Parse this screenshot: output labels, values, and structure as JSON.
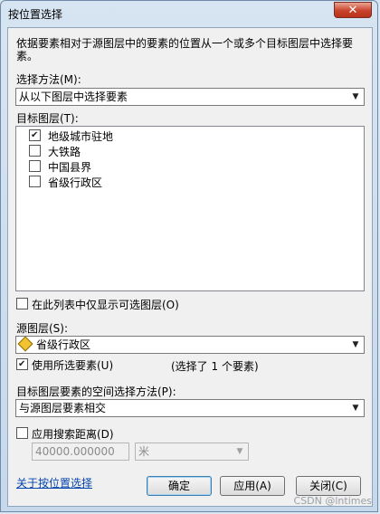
{
  "window": {
    "title": "按位置选择",
    "close_glyph": "✕"
  },
  "description": "依据要素相对于源图层中的要素的位置从一个或多个目标图层中选择要素。",
  "selection_method": {
    "label": "选择方法(M):",
    "value": "从以下图层中选择要素"
  },
  "target_layers": {
    "label": "目标图层(T):",
    "items": [
      {
        "label": "地级城市驻地",
        "checked": true
      },
      {
        "label": "大铁路",
        "checked": false
      },
      {
        "label": "中国县界",
        "checked": false
      },
      {
        "label": "省级行政区",
        "checked": false
      }
    ]
  },
  "only_selectable": {
    "label": "在此列表中仅显示可选图层(O)",
    "checked": false
  },
  "source_layer": {
    "label": "源图层(S):",
    "value": "省级行政区",
    "icon": "polygon-layer-icon"
  },
  "use_selected": {
    "label": "使用所选要素(U)",
    "checked": true,
    "info": "(选择了 1 个要素)"
  },
  "spatial_method": {
    "label": "目标图层要素的空间选择方法(P):",
    "value": "与源图层要素相交"
  },
  "search_distance": {
    "label": "应用搜索距离(D)",
    "checked": false,
    "value": "40000.000000",
    "unit": "米"
  },
  "footer": {
    "link": "关于按位置选择",
    "ok": "确定",
    "apply": "应用(A)",
    "close": "关闭(C)"
  },
  "watermark": "CSDN @lntimes"
}
